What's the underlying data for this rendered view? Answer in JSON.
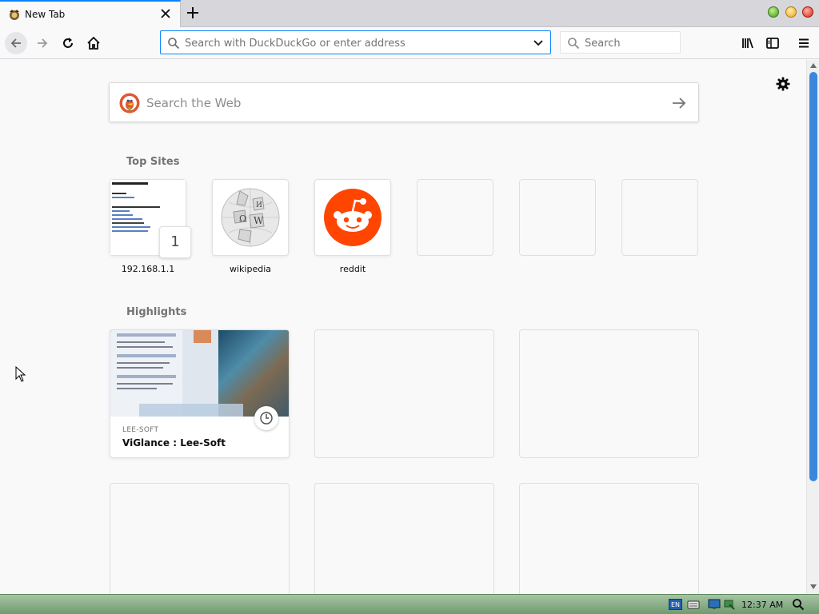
{
  "tab": {
    "title": "New Tab"
  },
  "urlbar": {
    "placeholder": "Search with DuckDuckGo or enter address",
    "value": ""
  },
  "searchbar": {
    "placeholder": "Search"
  },
  "websearch": {
    "placeholder": "Search the Web"
  },
  "sections": {
    "top_sites": "Top Sites",
    "highlights": "Highlights"
  },
  "top_sites": [
    {
      "label": "192.168.1.1",
      "badge": "1",
      "icon": "page-screenshot"
    },
    {
      "label": "wikipedia",
      "icon": "wikipedia-globe-icon"
    },
    {
      "label": "reddit",
      "icon": "reddit-icon"
    },
    {
      "label": ""
    },
    {
      "label": ""
    },
    {
      "label": ""
    }
  ],
  "highlights": [
    {
      "host": "LEE-SOFT",
      "title": "ViGlance : Lee-Soft",
      "icon": "clock-icon"
    }
  ],
  "taskbar": {
    "language": "EN",
    "time": "12:37 AM"
  },
  "colors": {
    "accent": "#0a84ff",
    "reddit": "#ff4500",
    "taskbar": "#8fb48d"
  }
}
